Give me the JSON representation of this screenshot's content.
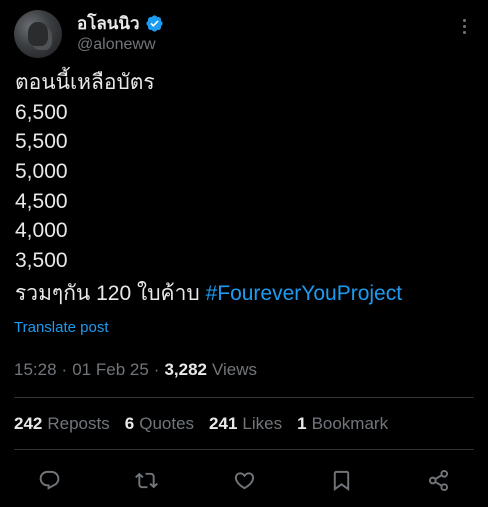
{
  "author": {
    "display_name": "อโลนนิว",
    "handle": "@aloneww",
    "verified": true,
    "avatar_icon": "avatar-photo"
  },
  "post": {
    "lines": [
      "ตอนนี้เหลือบัตร",
      "6,500",
      "5,500",
      "5,000",
      "4,500",
      "4,000",
      "3,500"
    ],
    "final_line_text": "รวมๆกัน 120 ใบค้าบ ",
    "hashtag": "#FoureverYouProject"
  },
  "translate_label": "Translate post",
  "meta": {
    "time": "15:28",
    "date": "01 Feb 25",
    "views_count": "3,282",
    "views_label": "Views"
  },
  "stats": [
    {
      "num": "242",
      "label": "Reposts"
    },
    {
      "num": "6",
      "label": "Quotes"
    },
    {
      "num": "241",
      "label": "Likes"
    },
    {
      "num": "1",
      "label": "Bookmark"
    }
  ],
  "colors": {
    "background": "#000000",
    "text": "#e7e9ea",
    "muted": "#71767b",
    "accent": "#1d9bf0",
    "divider": "#2f3336"
  },
  "actions": [
    "reply-icon",
    "repost-icon",
    "like-icon",
    "bookmark-icon",
    "share-icon"
  ]
}
